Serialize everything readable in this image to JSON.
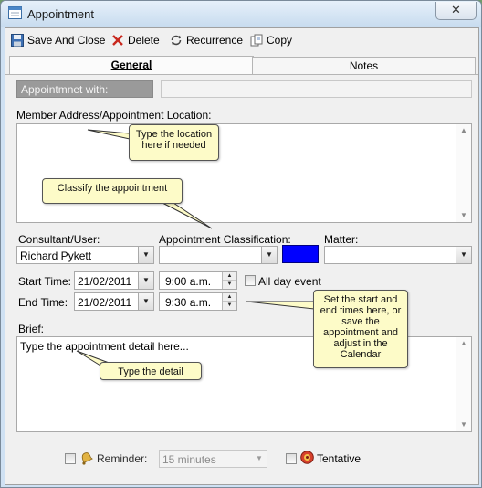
{
  "window": {
    "title": "Appointment",
    "close_glyph": "✕"
  },
  "toolbar": {
    "save_close": "Save And Close",
    "delete": "Delete",
    "recurrence": "Recurrence",
    "copy": "Copy"
  },
  "tabs": {
    "general": "General",
    "notes": "Notes"
  },
  "form": {
    "appointment_with_label": "Appointmnet with:",
    "appointment_with_value": "",
    "location_label": "Member Address/Appointment Location:",
    "location_value": "",
    "consultant_label": "Consultant/User:",
    "consultant_value": "Richard Pykett",
    "classification_label": "Appointment Classification:",
    "classification_value": "",
    "classification_color": "#0000ff",
    "matter_label": "Matter:",
    "matter_value": "",
    "start_label": "Start Time:",
    "start_date": "21/02/2011",
    "start_time": "9:00 a.m.",
    "end_label": "End Time:",
    "end_date": "21/02/2011",
    "end_time": "9:30 a.m.",
    "all_day_label": "All day event",
    "all_day_checked": false,
    "brief_label": "Brief:",
    "brief_value": "Type the appointment detail here...",
    "reminder_label": "Reminder:",
    "reminder_checked": false,
    "reminder_value": "15 minutes",
    "tentative_label": "Tentative",
    "tentative_checked": false
  },
  "callouts": {
    "location": "Type the location here if needed",
    "classify": "Classify the appointment",
    "times": "Set the start and end times here, or save the appointment and adjust in the Calendar",
    "detail": "Type the detail"
  },
  "glyphs": {
    "dropdown_arrow": "▼",
    "scroll_up": "▲",
    "scroll_down": "▼",
    "spin_up": "▲",
    "spin_down": "▼"
  }
}
